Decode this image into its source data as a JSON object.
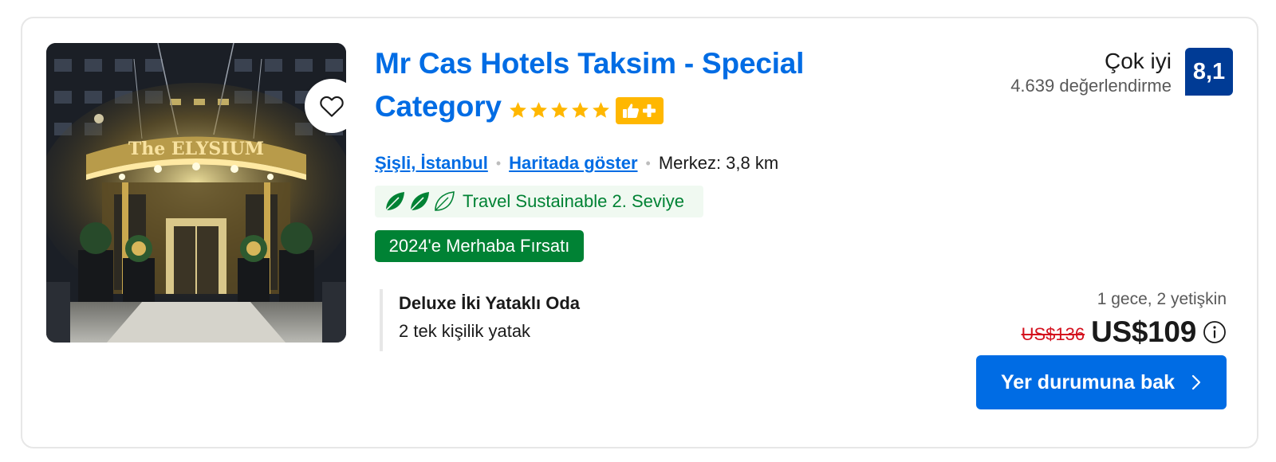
{
  "hotel": {
    "title": "Mr Cas Hotels Taksim - Special Category",
    "star_count": 5,
    "star_color": "#ffb700",
    "badge_icons": [
      "thumbs-up-icon",
      "plus-icon"
    ],
    "location_link": "Şişli, İstanbul",
    "map_link": "Haritada göster",
    "distance": "Merkez: 3,8 km",
    "photo_sign_text": "The ELYSIUM"
  },
  "sustainability": {
    "label": "Travel Sustainable 2. Seviye",
    "leaves_filled": 2,
    "leaves_total": 3,
    "color": "#008234"
  },
  "deal": {
    "label": "2024'e Merhaba Fırsatı"
  },
  "room": {
    "name": "Deluxe İki Yataklı Oda",
    "beds": "2 tek kişilik yatak"
  },
  "review": {
    "word": "Çok iyi",
    "count": "4.639 değerlendirme",
    "score": "8,1"
  },
  "price": {
    "stay": "1 gece, 2 yetişkin",
    "original": "US$136",
    "current": "US$109"
  },
  "cta": {
    "label": "Yer durumuna bak"
  },
  "colors": {
    "brand_blue": "#006ce4",
    "score_bg": "#003b95",
    "deal_green": "#008234",
    "price_red": "#d4111e"
  }
}
